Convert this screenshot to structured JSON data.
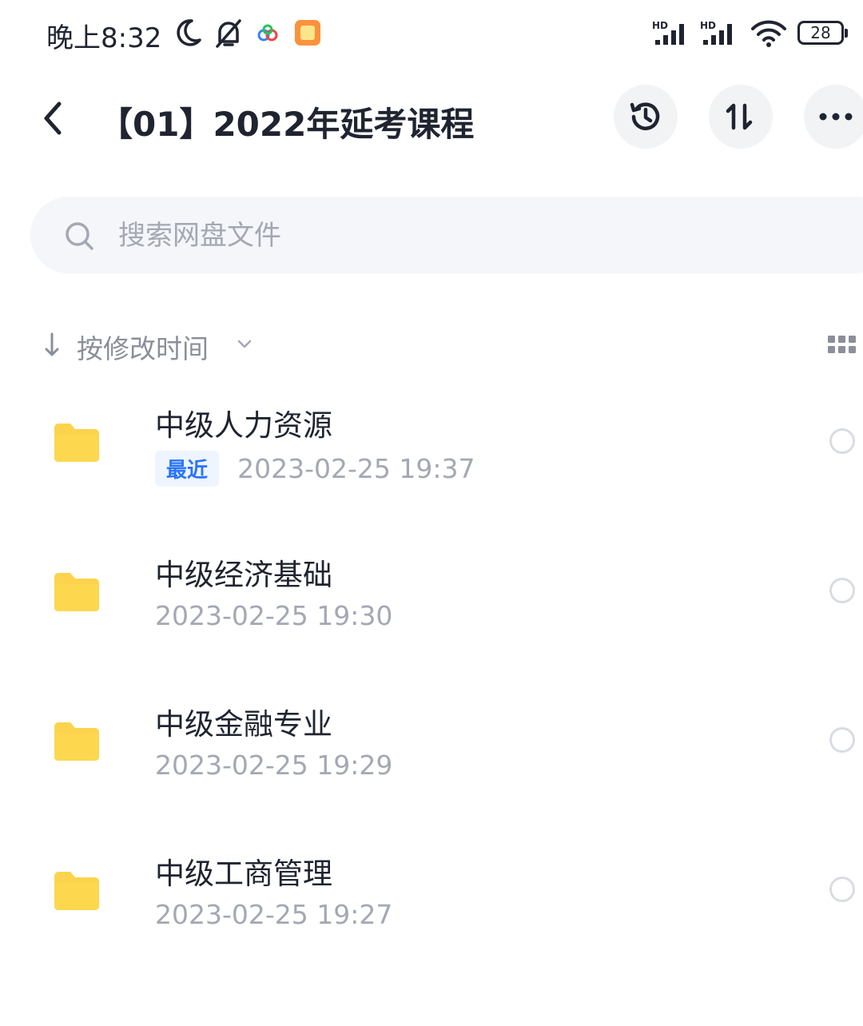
{
  "status_bar": {
    "time": "晚上8:32",
    "battery": "28",
    "icons": [
      "moon-icon",
      "bell-off-icon",
      "app-notification-icon",
      "gallery-notification-icon",
      "hd-signal-icon",
      "hd-signal-icon",
      "wifi-icon",
      "battery-icon"
    ]
  },
  "header": {
    "title": "【01】2022年延考课程",
    "icons": [
      "back-icon",
      "history-icon",
      "sort-icon",
      "more-icon"
    ]
  },
  "search": {
    "placeholder": "搜索网盘文件"
  },
  "sort": {
    "label": "按修改时间"
  },
  "files": [
    {
      "name": "中级人力资源",
      "badge": "最近",
      "date": "2023-02-25  19:37"
    },
    {
      "name": "中级经济基础",
      "date": "2023-02-25  19:30"
    },
    {
      "name": "中级金融专业",
      "date": "2023-02-25  19:29"
    },
    {
      "name": "中级工商管理",
      "date": "2023-02-25  19:27"
    }
  ],
  "colors": {
    "folder": "#fcd34d",
    "badge_text": "#2a74ff",
    "badge_bg": "#eef5ff",
    "muted_text": "#a4a8b3"
  }
}
